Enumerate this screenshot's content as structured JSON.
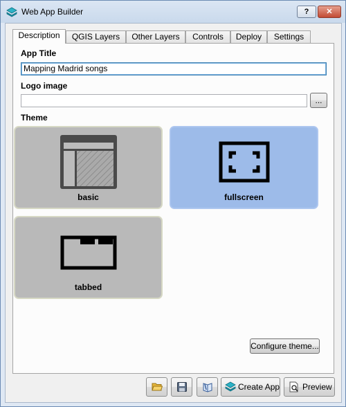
{
  "window": {
    "title": "Web App Builder",
    "help_label": "?",
    "close_label": "✕"
  },
  "tabs": [
    {
      "label": "Description",
      "active": true
    },
    {
      "label": "QGIS Layers",
      "active": false
    },
    {
      "label": "Other Layers",
      "active": false
    },
    {
      "label": "Controls",
      "active": false
    },
    {
      "label": "Deploy",
      "active": false
    },
    {
      "label": "Settings",
      "active": false
    }
  ],
  "description": {
    "app_title_label": "App Title",
    "app_title_value": "Mapping Madrid songs",
    "logo_label": "Logo image",
    "logo_value": "",
    "browse_label": "...",
    "theme_label": "Theme",
    "themes": [
      {
        "name": "basic",
        "selected": false,
        "icon": "basic-layout-icon"
      },
      {
        "name": "fullscreen",
        "selected": true,
        "icon": "fullscreen-icon"
      },
      {
        "name": "tabbed",
        "selected": false,
        "icon": "tabbed-icon"
      }
    ],
    "configure_label": "Configure theme..."
  },
  "bottom_bar": {
    "open_icon": "folder-icon",
    "save_icon": "floppy-disk-icon",
    "help_icon": "book-icon",
    "create_label": "Create App",
    "preview_label": "Preview"
  },
  "colors": {
    "selected_theme": "#9dbbe9",
    "unselected_theme": "#b9b9b9",
    "focus_border": "#3c7fb1"
  }
}
